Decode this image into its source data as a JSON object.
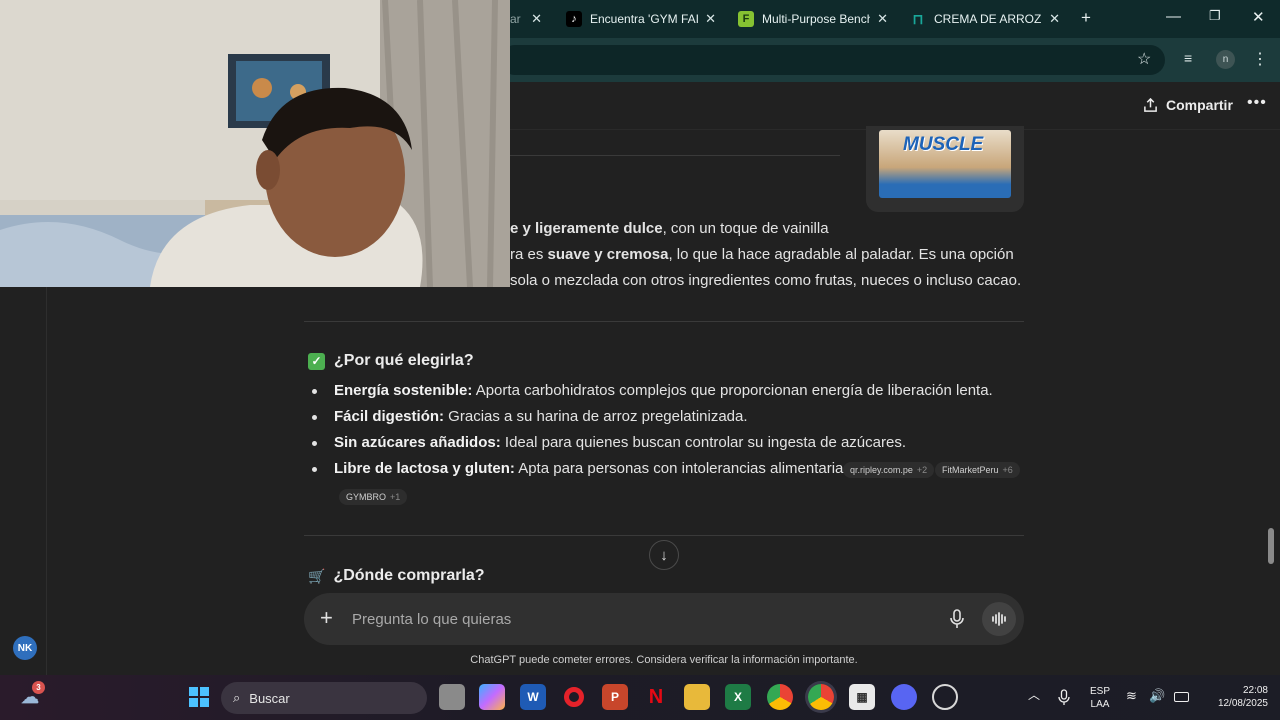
{
  "browser": {
    "tabs": [
      {
        "label": "ar",
        "favicon": "generic",
        "color": "#2a2a2a"
      },
      {
        "label": "Encuentra 'GYM FAIL",
        "favicon": "tiktok-icon",
        "color": "#000000"
      },
      {
        "label": "Multi-Purpose Bench",
        "favicon": "f-icon",
        "color": "#86c232"
      },
      {
        "label": "CREMA DE ARROZ S",
        "favicon": "store-icon",
        "color": "#19a89a"
      }
    ],
    "new_tab_symbol": "+",
    "profile_initial": "n"
  },
  "header": {
    "share_label": "Compartir"
  },
  "product_image": {
    "brand": "MUSCLE"
  },
  "description": {
    "line1_bold": "e y ligeramente dulce",
    "line1_rest": ", con un toque de vainilla",
    "line2_pre": "ra es ",
    "line2_bold": "suave y cremosa",
    "line2_rest": ", lo que la hace agradable al paladar. Es una opción",
    "line3": "sola o mezclada con otros ingredientes como frutas, nueces o incluso cacao."
  },
  "why_section": {
    "heading": "¿Por qué elegirla?",
    "bullets": [
      {
        "bold": "Energía sostenible:",
        "text": " Aporta carbohidratos complejos que proporcionan energía de liberación lenta."
      },
      {
        "bold": "Fácil digestión:",
        "text": " Gracias a su harina de arroz pregelatinizada."
      },
      {
        "bold": "Sin azúcares añadidos:",
        "text": " Ideal para quienes buscan controlar su ingesta de azúcares."
      },
      {
        "bold": "Libre de lactosa y gluten:",
        "text": " Apta para personas con intolerancias alimentarias."
      }
    ],
    "sources": [
      {
        "name": "qr.ripley.com.pe",
        "count": "+2"
      },
      {
        "name": "FitMarketPeru",
        "count": "+6"
      },
      {
        "name": "GYMBRO",
        "count": "+1"
      }
    ]
  },
  "where_section": {
    "heading": "¿Dónde comprarla?"
  },
  "composer": {
    "placeholder": "Pregunta lo que quieras"
  },
  "disclaimer": "ChatGPT puede cometer errores. Considera verificar la información importante.",
  "account_badge": "NK",
  "taskbar": {
    "search_label": "Buscar",
    "weather_badge": "3",
    "lang_top": "ESP",
    "lang_bottom": "LAA",
    "time": "22:08",
    "date": "12/08/2025"
  },
  "colors": {
    "accent_green": "#4caf50",
    "tab_strip": "#0f2a2b",
    "background": "#212121"
  }
}
